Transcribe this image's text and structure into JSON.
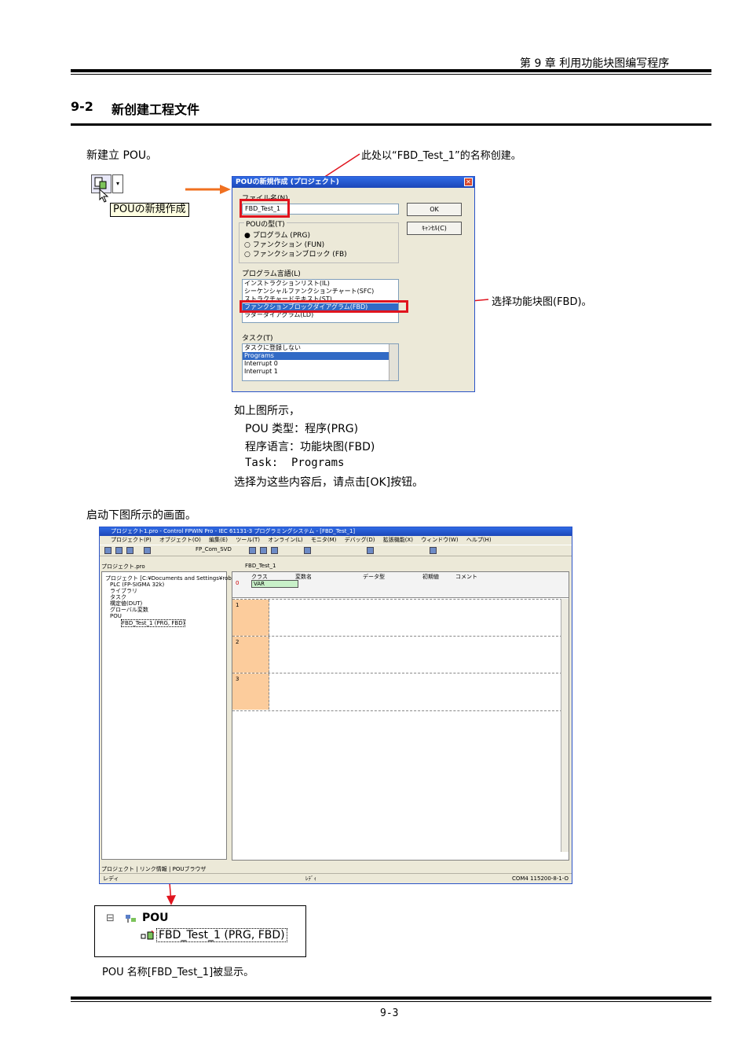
{
  "header": {
    "chapter": "第 9 章 利用功能块图编写程序"
  },
  "section": {
    "number": "9-2",
    "title": "新创建工程文件"
  },
  "step1": {
    "intro": "新建立 POU。",
    "tooltip": "POUの新規作成",
    "callout_name": "此处以“FBD_Test_1”的名称创建。",
    "callout_lang": "选择功能块图(FBD)。"
  },
  "dialog": {
    "title": "POUの新規作成 (プロジェクト)",
    "close": "✕",
    "file_label": "ファイル名(N)",
    "file_value": "FBD_Test_1",
    "ok_button": "OK",
    "cancel_button": "ｷｬﾝｾﾙ(C)",
    "type_group": "POUの型(T)",
    "types": [
      "プログラム (PRG)",
      "ファンクション (FUN)",
      "ファンクションブロック (FB)"
    ],
    "lang_label": "プログラム言語(L)",
    "languages": [
      "インストラクションリスト(IL)",
      "シーケンシャルファンクションチャート(SFC)",
      "ストラクチャードテキスト(ST)",
      "ファンクションブロックダイアグラム(FBD)",
      "ラダーダイアグラム(LD)"
    ],
    "task_label": "タスク(T)",
    "tasks": [
      "タスクに登録しない",
      "Programs",
      "Interrupt 0",
      "Interrupt 1"
    ]
  },
  "explain": {
    "line1": "如上图所示，",
    "line2": "POU 类型：程序(PRG)",
    "line3": "程序语言：功能块图(FBD)",
    "line4": "Task:  Programs",
    "line5": "选择为这些内容后，请点击[OK]按钮。"
  },
  "step2": {
    "intro": "启动下图所示的画面。"
  },
  "ide": {
    "title": "プロジェクト1.pro - Control FPWIN Pro - IEC 61131-3 プログラミングシステム - [FBD_Test_1]",
    "menus": [
      "プロジェクト(P)",
      "オブジェクト(O)",
      "編集(E)",
      "ツール(T)",
      "オンライン(L)",
      "モニタ(M)",
      "デバッグ(D)",
      "拡張機能(X)",
      "ウィンドウ(W)",
      "ヘルプ(H)"
    ],
    "toolbar_combo": "FP_Com_SVD",
    "tree_tab": "プロジェクト.pro",
    "editor_tab": "FBD_Test_1",
    "tree": [
      "プロジェクト [C:¥Documents and Settings¥robot",
      "PLC (FP-SIGMA 32k)",
      "ライブラリ",
      "タスク",
      "構定値(DUT)",
      "グローバル変数",
      "POU",
      "FBD_Test_1 (PRG, FBD)"
    ],
    "var_columns": [
      "クラス",
      "変数名",
      "データ型",
      "初期値",
      "コメント"
    ],
    "var_row_num": "0",
    "var_row_class": "VAR",
    "rows": [
      "1",
      "2",
      "3"
    ],
    "bottom_tabs": [
      "プロジェクト",
      "リンク情報",
      "POUブラウザ"
    ],
    "status_left": "レディ",
    "status_mid": "ﾚﾃﾞｨ",
    "status_right": "COM4 115200-8-1-O"
  },
  "inset": {
    "node": "POU",
    "item": "FBD_Test_1 (PRG, FBD)"
  },
  "caption": "POU 名称[FBD_Test_1]被显示。",
  "footer": {
    "page": "9-3"
  },
  "colors": {
    "accent_red": "#e0141e",
    "arrow_orange": "#f07020",
    "title_blue": "#1c46b8",
    "row_orange": "#fccc9c"
  }
}
